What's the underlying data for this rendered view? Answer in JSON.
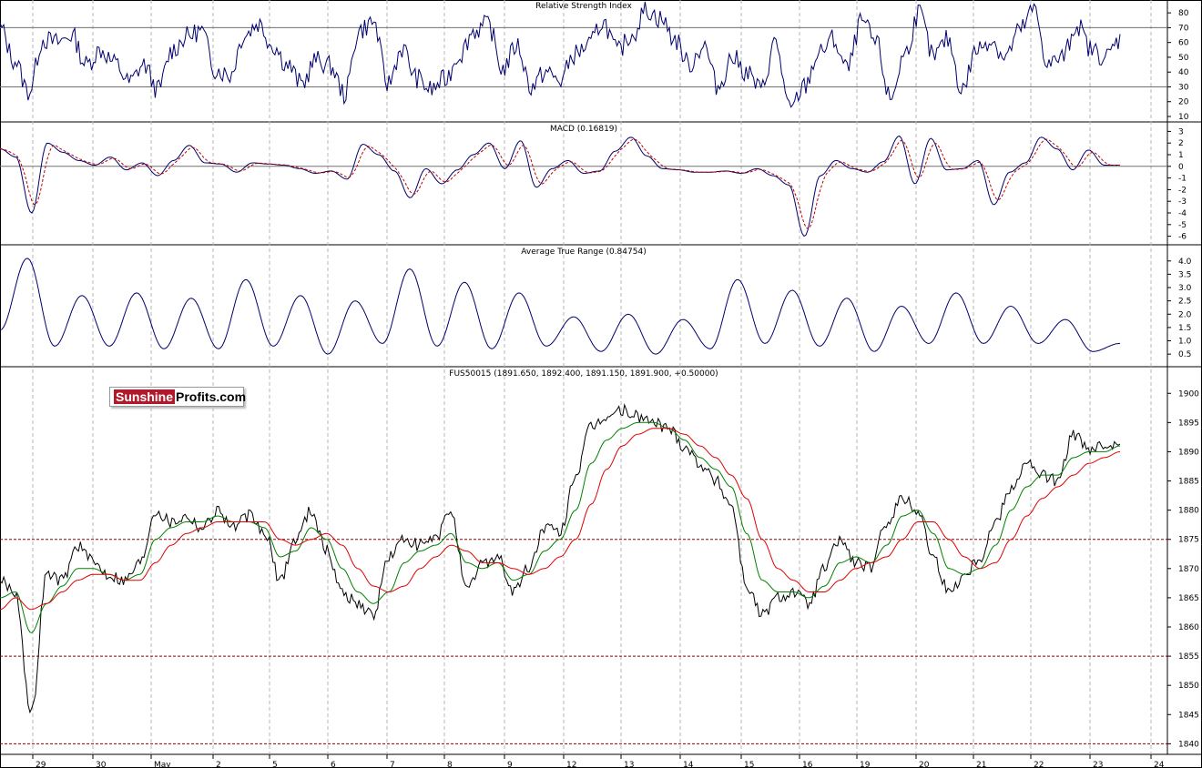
{
  "logo": {
    "part1": "Sunshine",
    "part2": "Profits.com"
  },
  "x_axis": {
    "labels": [
      "29",
      "30",
      "May",
      "2",
      "5",
      "6",
      "7",
      "8",
      "9",
      "12",
      "13",
      "14",
      "15",
      "16",
      "19",
      "20",
      "21",
      "22",
      "23",
      "24"
    ]
  },
  "chart_data": [
    {
      "type": "line",
      "title": "Relative Strength Index",
      "ylim": [
        10,
        85
      ],
      "yticks": [
        10,
        20,
        30,
        40,
        50,
        60,
        70,
        80
      ],
      "reference_lines": [
        30,
        70
      ],
      "series": [
        {
          "values": [
            70,
            48,
            27,
            62,
            60,
            65,
            45,
            55,
            46,
            33,
            45,
            28,
            55,
            64,
            68,
            42,
            38,
            65,
            73,
            58,
            45,
            32,
            48,
            44,
            25,
            68,
            74,
            32,
            56,
            36,
            28,
            35,
            52,
            68,
            72,
            42,
            58,
            30,
            40,
            34,
            52,
            58,
            74,
            54,
            65,
            82,
            76,
            62,
            45,
            58,
            30,
            50,
            40,
            28,
            60,
            14,
            30,
            52,
            62,
            42,
            74,
            60,
            22,
            52,
            80,
            50,
            62,
            28,
            55,
            62,
            50,
            68,
            82,
            45,
            50,
            72,
            55,
            50,
            62
          ]
        }
      ]
    },
    {
      "type": "line",
      "title": "MACD (0.16819)",
      "ylim": [
        -6.5,
        3.5
      ],
      "yticks": [
        -6,
        -5,
        -4,
        -3,
        -2,
        -1,
        0,
        1,
        2,
        3
      ],
      "reference_lines": [
        0
      ],
      "series": [
        {
          "values": [
            1.5,
            0.8,
            -4,
            2,
            1.2,
            0.5,
            0.1,
            0.8,
            -0.3,
            0.3,
            -0.8,
            0.5,
            1.8,
            0.3,
            0.2,
            -0.5,
            0.3,
            0.2,
            0.1,
            -0.2,
            -0.6,
            -0.4,
            -1.1,
            1.9,
            1.0,
            -0.4,
            -2.7,
            -0.2,
            -1.5,
            -0.3,
            1.0,
            2.0,
            -0.2,
            2.2,
            -1.8,
            -0.2,
            0.5,
            -0.6,
            -0.4,
            1.3,
            2.5,
            0.9,
            -0.2,
            -0.3,
            -0.5,
            -0.5,
            -0.4,
            -0.6,
            -0.2,
            -0.8,
            -1.6,
            -6.0,
            -0.8,
            0.5,
            -0.2,
            -0.5,
            0.4,
            2.6,
            -1.5,
            2.4,
            -0.3,
            -0.2,
            0.5,
            -3.3,
            -0.5,
            0.3,
            2.5,
            1.5,
            -0.3,
            1.4,
            0.1,
            0.1
          ]
        }
      ]
    },
    {
      "type": "line",
      "title": "Average True Range (0.84754)",
      "ylim": [
        0.3,
        4.3
      ],
      "yticks": [
        0.5,
        1.0,
        1.5,
        2.0,
        2.5,
        3.0,
        3.5,
        4.0
      ],
      "series": [
        {
          "values": [
            1.4,
            4.1,
            0.8,
            2.7,
            0.8,
            2.8,
            0.7,
            2.6,
            0.7,
            3.3,
            0.8,
            2.7,
            0.5,
            2.5,
            0.9,
            3.7,
            0.8,
            3.2,
            0.7,
            2.8,
            0.8,
            1.9,
            0.6,
            2.0,
            0.5,
            1.8,
            0.7,
            3.3,
            0.9,
            2.9,
            0.8,
            2.6,
            0.6,
            2.3,
            0.9,
            2.8,
            0.9,
            2.3,
            0.9,
            1.8,
            0.6,
            0.9
          ]
        }
      ]
    },
    {
      "type": "line",
      "title": "FUS50015 (1891.650, 1892.400, 1891.150, 1891.900, +0.50000)",
      "ylim": [
        1838.5,
        1903
      ],
      "yticks": [
        1840,
        1845,
        1850,
        1855,
        1860,
        1865,
        1870,
        1875,
        1880,
        1885,
        1890,
        1895,
        1900
      ],
      "reference_lines": [
        1875,
        1855,
        1840
      ],
      "series": [
        {
          "color": "#000000",
          "values": [
            1868,
            1866,
            1845,
            1869,
            1868,
            1874,
            1871,
            1869,
            1868,
            1871,
            1880,
            1878,
            1879,
            1877,
            1880,
            1877,
            1879,
            1876,
            1868,
            1875,
            1880,
            1873,
            1866,
            1864,
            1862,
            1872,
            1875,
            1874,
            1875,
            1880,
            1866,
            1871,
            1872,
            1866,
            1870,
            1877,
            1876,
            1886,
            1894,
            1896,
            1897,
            1896,
            1895,
            1894,
            1891,
            1888,
            1885,
            1881,
            1867,
            1862,
            1865,
            1866,
            1864,
            1870,
            1875,
            1871,
            1870,
            1878,
            1882,
            1880,
            1872,
            1866,
            1869,
            1872,
            1878,
            1884,
            1888,
            1886,
            1885,
            1893,
            1890,
            1891,
            1892
          ]
        },
        {
          "color": "#008000",
          "values": [
            1865,
            1866,
            1859,
            1864,
            1867,
            1870,
            1870,
            1869,
            1868,
            1869,
            1875,
            1877,
            1878,
            1878,
            1879,
            1878,
            1878,
            1877,
            1872,
            1873,
            1877,
            1875,
            1870,
            1866,
            1864,
            1866,
            1871,
            1873,
            1874,
            1876,
            1871,
            1870,
            1871,
            1868,
            1869,
            1873,
            1875,
            1880,
            1888,
            1892,
            1894,
            1895,
            1895,
            1894,
            1892,
            1889,
            1887,
            1884,
            1876,
            1868,
            1866,
            1866,
            1865,
            1867,
            1871,
            1872,
            1871,
            1874,
            1879,
            1880,
            1876,
            1870,
            1869,
            1870,
            1874,
            1880,
            1884,
            1886,
            1886,
            1889,
            1890,
            1890,
            1891
          ]
        },
        {
          "color": "#e00000",
          "values": [
            1863,
            1865,
            1863,
            1864,
            1866,
            1868,
            1869,
            1869,
            1868,
            1868,
            1871,
            1874,
            1876,
            1877,
            1878,
            1878,
            1878,
            1878,
            1875,
            1874,
            1875,
            1876,
            1874,
            1870,
            1867,
            1866,
            1867,
            1870,
            1872,
            1874,
            1873,
            1871,
            1871,
            1870,
            1869,
            1870,
            1872,
            1875,
            1881,
            1887,
            1891,
            1893,
            1894,
            1894,
            1893,
            1891,
            1889,
            1886,
            1882,
            1875,
            1870,
            1868,
            1866,
            1866,
            1868,
            1870,
            1871,
            1872,
            1875,
            1878,
            1878,
            1875,
            1872,
            1870,
            1871,
            1875,
            1879,
            1882,
            1884,
            1886,
            1888,
            1889,
            1890
          ]
        }
      ]
    }
  ]
}
